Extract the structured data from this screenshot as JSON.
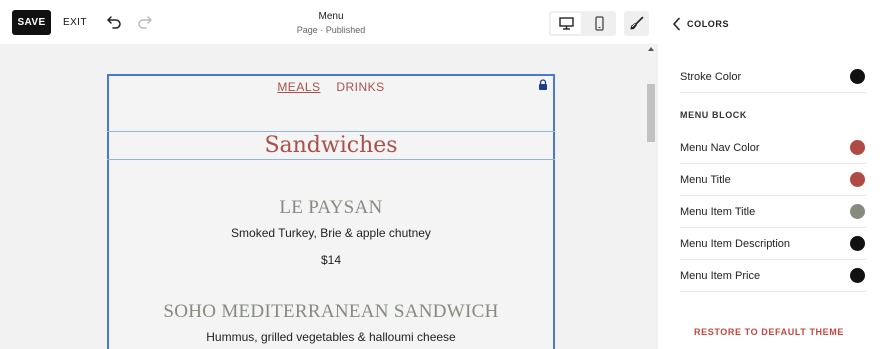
{
  "toolbar": {
    "save_label": "SAVE",
    "exit_label": "EXIT",
    "page_title": "Menu",
    "page_status": "Page · Published"
  },
  "menu": {
    "nav": [
      {
        "label": "MEALS",
        "active": true
      },
      {
        "label": "DRINKS",
        "active": false
      }
    ],
    "title": "Sandwiches",
    "items": [
      {
        "title": "LE PAYSAN",
        "description": "Smoked Turkey, Brie & apple chutney",
        "price": "$14"
      },
      {
        "title": "SOHO MEDITERRANEAN SANDWICH",
        "description": "Hummus, grilled vegetables & halloumi cheese"
      }
    ]
  },
  "panel": {
    "header": "COLORS",
    "stroke_row": {
      "label": "Stroke Color",
      "color": "#111111"
    },
    "section_label": "MENU BLOCK",
    "rows": [
      {
        "label": "Menu Nav Color",
        "color": "#b04a44"
      },
      {
        "label": "Menu Title",
        "color": "#b04a44"
      },
      {
        "label": "Menu Item Title",
        "color": "#868b80"
      },
      {
        "label": "Menu Item Description",
        "color": "#111111"
      },
      {
        "label": "Menu Item Price",
        "color": "#111111"
      }
    ],
    "restore_label": "RESTORE TO DEFAULT THEME"
  },
  "icons": {
    "undo": "undo-icon",
    "redo": "redo-icon",
    "desktop": "desktop-icon",
    "mobile": "mobile-icon",
    "brush": "paintbrush-icon",
    "lock": "lock-icon",
    "back": "chevron-left-icon"
  },
  "colors": {
    "accent_blue": "#4a78d9",
    "nav_red": "#a9504c",
    "item_gray": "#868b80",
    "restore_red": "#c8453f"
  }
}
